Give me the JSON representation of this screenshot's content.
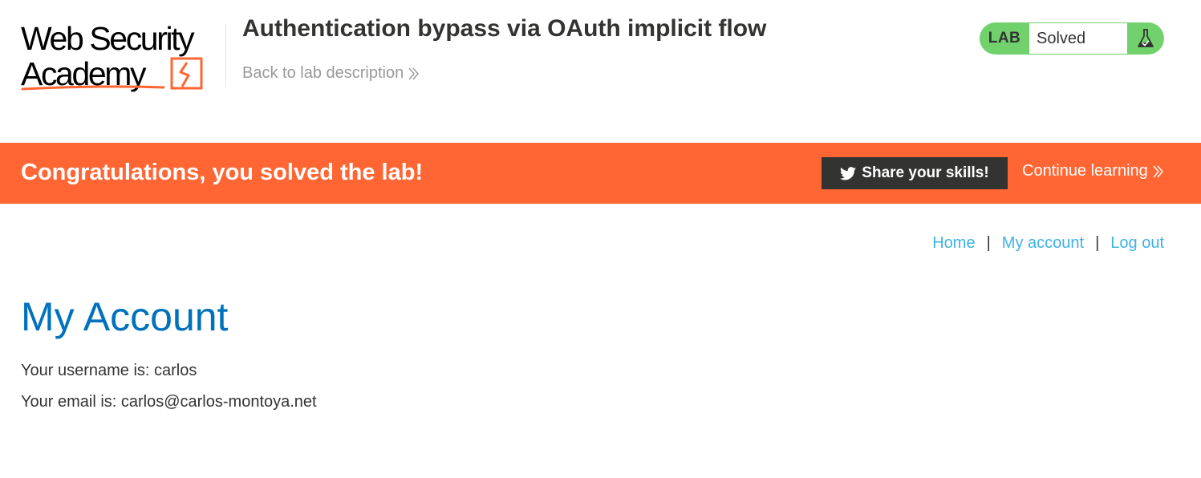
{
  "logo": {
    "line1": "Web Security",
    "line2": "Academy",
    "accent_color": "#ff6633"
  },
  "header": {
    "title": "Authentication bypass via OAuth implicit flow",
    "back_link": "Back to lab description"
  },
  "lab_status": {
    "badge": "LAB",
    "status": "Solved",
    "icon": "flask-check-icon",
    "color": "#70d16d"
  },
  "banner": {
    "message": "Congratulations, you solved the lab!",
    "share_button": "Share your skills!",
    "share_icon": "twitter-icon",
    "continue_link": "Continue learning",
    "color": "#ff6633"
  },
  "nav": {
    "items": [
      "Home",
      "My account",
      "Log out"
    ],
    "separator": "|"
  },
  "account": {
    "heading": "My Account",
    "username_line": "Your username is: carlos",
    "email_line": "Your email is: carlos@carlos-montoya.net"
  }
}
